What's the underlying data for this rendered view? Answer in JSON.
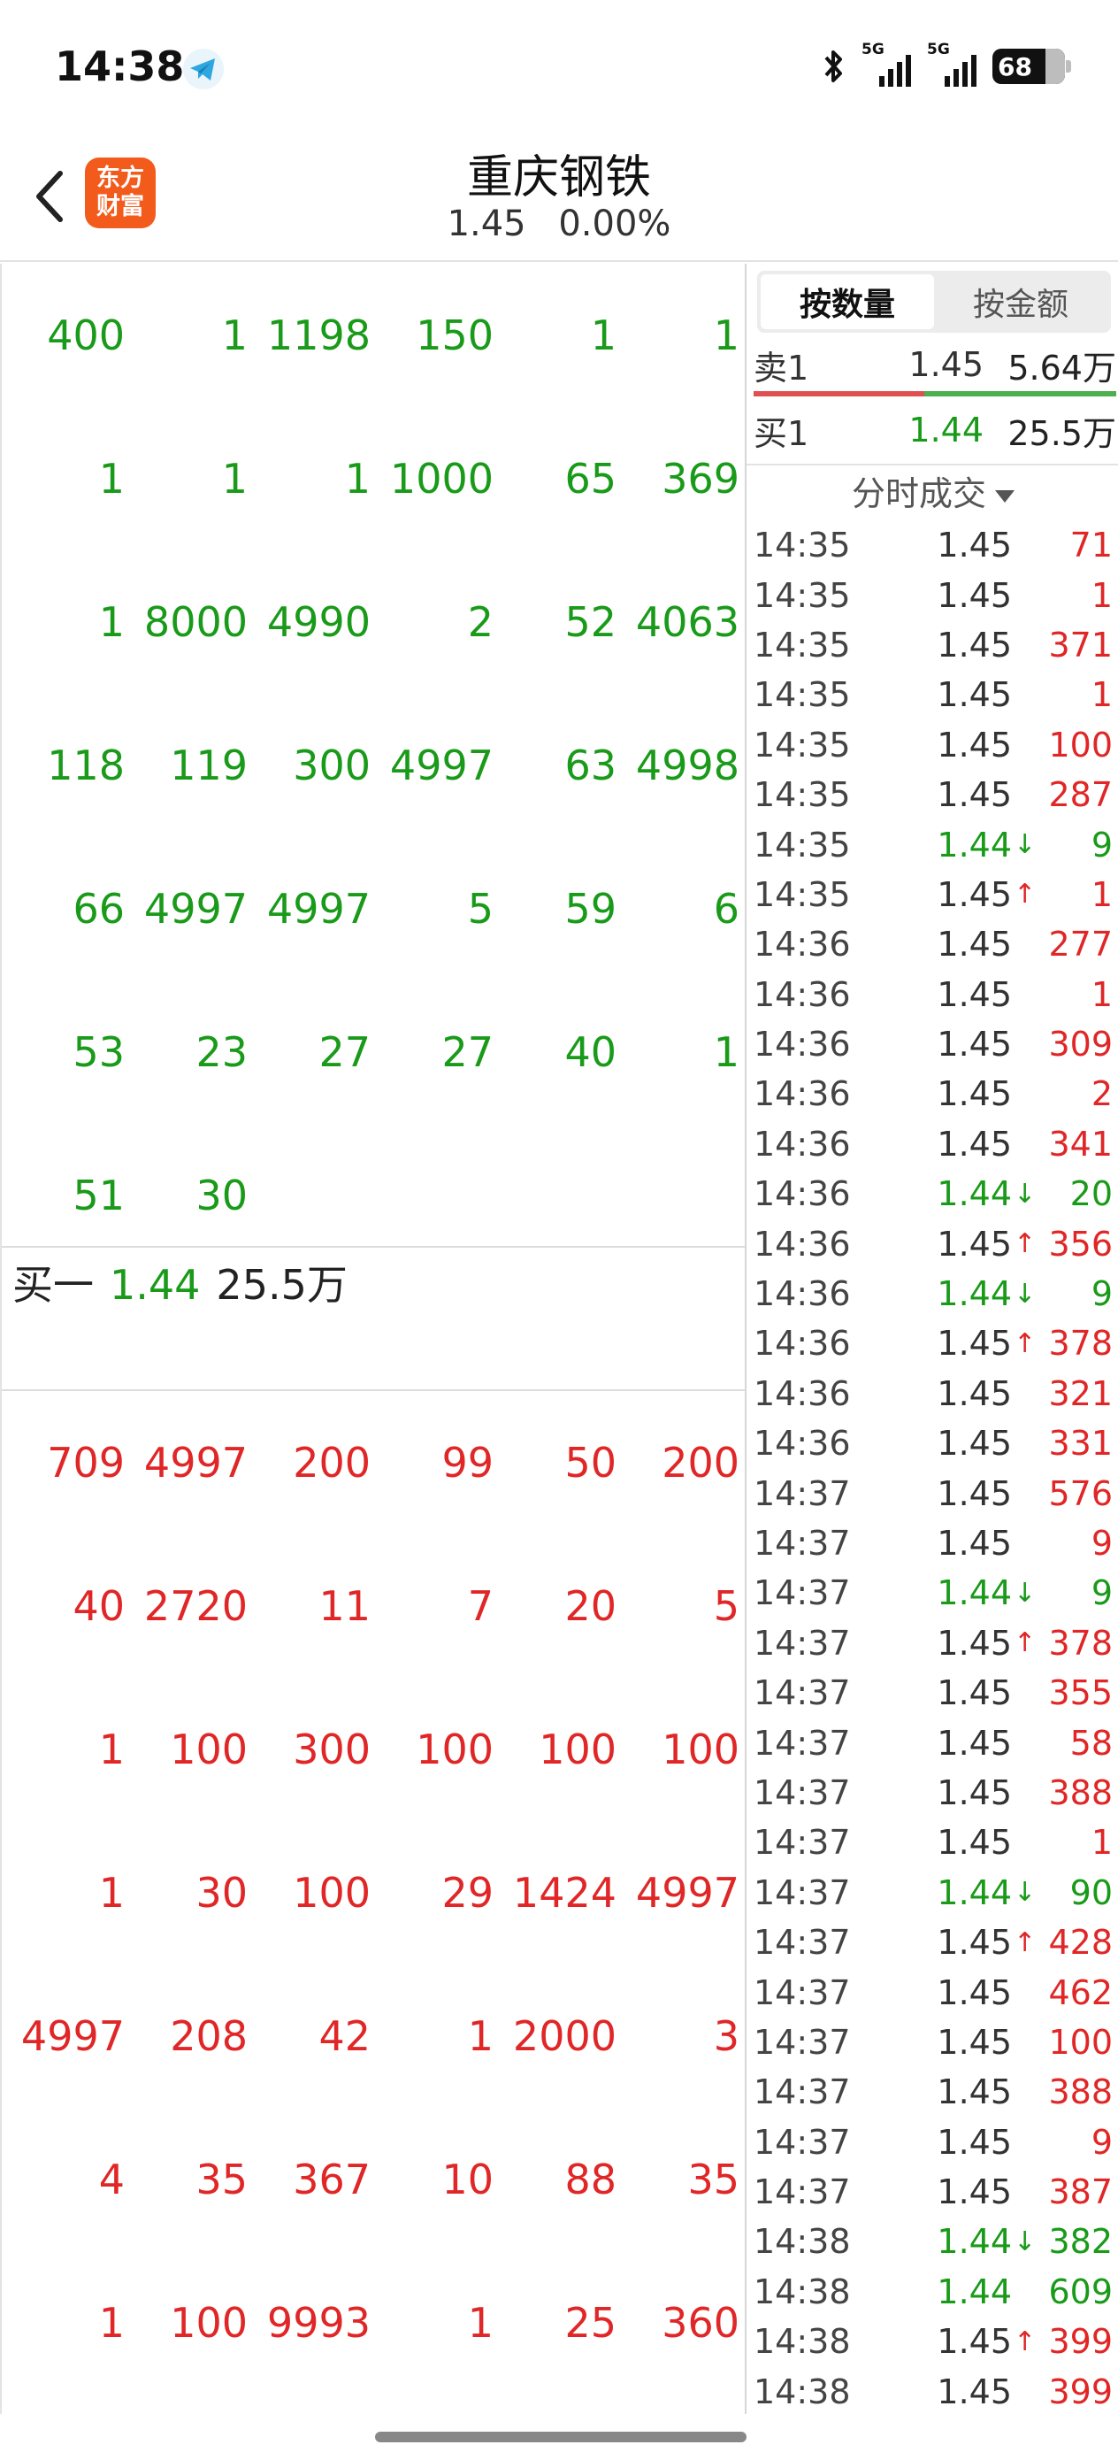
{
  "status_bar": {
    "time": "14:38",
    "net1": "5G",
    "net2": "5G",
    "battery": "68"
  },
  "header": {
    "logo": [
      "东方",
      "财富"
    ],
    "title": "重庆钢铁",
    "price": "1.45",
    "change": "0.00%"
  },
  "sell_queue": [
    [
      "400",
      "1",
      "1198",
      "150",
      "1",
      "1"
    ],
    [
      "1",
      "1",
      "1",
      "1000",
      "65",
      "369"
    ],
    [
      "1",
      "8000",
      "4990",
      "2",
      "52",
      "4063"
    ],
    [
      "118",
      "119",
      "300",
      "4997",
      "63",
      "4998"
    ],
    [
      "66",
      "4997",
      "4997",
      "5",
      "59",
      "6"
    ],
    [
      "53",
      "23",
      "27",
      "27",
      "40",
      "1"
    ],
    [
      "51",
      "30",
      "",
      "",
      "",
      ""
    ]
  ],
  "buy_one": {
    "label": "买一",
    "price": "1.44",
    "volume": "25.5万"
  },
  "buy_queue": [
    [
      "709",
      "4997",
      "200",
      "99",
      "50",
      "200"
    ],
    [
      "40",
      "2720",
      "11",
      "7",
      "20",
      "5"
    ],
    [
      "1",
      "100",
      "300",
      "100",
      "100",
      "100"
    ],
    [
      "1",
      "30",
      "100",
      "29",
      "1424",
      "4997"
    ],
    [
      "4997",
      "208",
      "42",
      "1",
      "2000",
      "3"
    ],
    [
      "4",
      "35",
      "367",
      "10",
      "88",
      "35"
    ],
    [
      "1",
      "100",
      "9993",
      "1",
      "25",
      "360"
    ]
  ],
  "right_panel": {
    "toggle": [
      "按数量",
      "按金额"
    ],
    "sell1": {
      "label": "卖1",
      "price": "1.45",
      "volume": "5.64万"
    },
    "buy1": {
      "label": "买1",
      "price": "1.44",
      "volume": "25.5万"
    },
    "trades_label": "分时成交"
  },
  "trades": [
    {
      "time": "14:35",
      "price": "1.45",
      "arrow": "",
      "vol": "71",
      "pc": "n",
      "vc": "r"
    },
    {
      "time": "14:35",
      "price": "1.45",
      "arrow": "",
      "vol": "1",
      "pc": "n",
      "vc": "r"
    },
    {
      "time": "14:35",
      "price": "1.45",
      "arrow": "",
      "vol": "371",
      "pc": "n",
      "vc": "r"
    },
    {
      "time": "14:35",
      "price": "1.45",
      "arrow": "",
      "vol": "1",
      "pc": "n",
      "vc": "r"
    },
    {
      "time": "14:35",
      "price": "1.45",
      "arrow": "",
      "vol": "100",
      "pc": "n",
      "vc": "r"
    },
    {
      "time": "14:35",
      "price": "1.45",
      "arrow": "",
      "vol": "287",
      "pc": "n",
      "vc": "r"
    },
    {
      "time": "14:35",
      "price": "1.44",
      "arrow": "↓",
      "vol": "9",
      "pc": "g",
      "vc": "g"
    },
    {
      "time": "14:35",
      "price": "1.45",
      "arrow": "↑",
      "vol": "1",
      "pc": "n",
      "vc": "r"
    },
    {
      "time": "14:36",
      "price": "1.45",
      "arrow": "",
      "vol": "277",
      "pc": "n",
      "vc": "r"
    },
    {
      "time": "14:36",
      "price": "1.45",
      "arrow": "",
      "vol": "1",
      "pc": "n",
      "vc": "r"
    },
    {
      "time": "14:36",
      "price": "1.45",
      "arrow": "",
      "vol": "309",
      "pc": "n",
      "vc": "r"
    },
    {
      "time": "14:36",
      "price": "1.45",
      "arrow": "",
      "vol": "2",
      "pc": "n",
      "vc": "r"
    },
    {
      "time": "14:36",
      "price": "1.45",
      "arrow": "",
      "vol": "341",
      "pc": "n",
      "vc": "r"
    },
    {
      "time": "14:36",
      "price": "1.44",
      "arrow": "↓",
      "vol": "20",
      "pc": "g",
      "vc": "g"
    },
    {
      "time": "14:36",
      "price": "1.45",
      "arrow": "↑",
      "vol": "356",
      "pc": "n",
      "vc": "r"
    },
    {
      "time": "14:36",
      "price": "1.44",
      "arrow": "↓",
      "vol": "9",
      "pc": "g",
      "vc": "g"
    },
    {
      "time": "14:36",
      "price": "1.45",
      "arrow": "↑",
      "vol": "378",
      "pc": "n",
      "vc": "r"
    },
    {
      "time": "14:36",
      "price": "1.45",
      "arrow": "",
      "vol": "321",
      "pc": "n",
      "vc": "r"
    },
    {
      "time": "14:36",
      "price": "1.45",
      "arrow": "",
      "vol": "331",
      "pc": "n",
      "vc": "r"
    },
    {
      "time": "14:37",
      "price": "1.45",
      "arrow": "",
      "vol": "576",
      "pc": "n",
      "vc": "r"
    },
    {
      "time": "14:37",
      "price": "1.45",
      "arrow": "",
      "vol": "9",
      "pc": "n",
      "vc": "r"
    },
    {
      "time": "14:37",
      "price": "1.44",
      "arrow": "↓",
      "vol": "9",
      "pc": "g",
      "vc": "g"
    },
    {
      "time": "14:37",
      "price": "1.45",
      "arrow": "↑",
      "vol": "378",
      "pc": "n",
      "vc": "r"
    },
    {
      "time": "14:37",
      "price": "1.45",
      "arrow": "",
      "vol": "355",
      "pc": "n",
      "vc": "r"
    },
    {
      "time": "14:37",
      "price": "1.45",
      "arrow": "",
      "vol": "58",
      "pc": "n",
      "vc": "r"
    },
    {
      "time": "14:37",
      "price": "1.45",
      "arrow": "",
      "vol": "388",
      "pc": "n",
      "vc": "r"
    },
    {
      "time": "14:37",
      "price": "1.45",
      "arrow": "",
      "vol": "1",
      "pc": "n",
      "vc": "r"
    },
    {
      "time": "14:37",
      "price": "1.44",
      "arrow": "↓",
      "vol": "90",
      "pc": "g",
      "vc": "g"
    },
    {
      "time": "14:37",
      "price": "1.45",
      "arrow": "↑",
      "vol": "428",
      "pc": "n",
      "vc": "r"
    },
    {
      "time": "14:37",
      "price": "1.45",
      "arrow": "",
      "vol": "462",
      "pc": "n",
      "vc": "r"
    },
    {
      "time": "14:37",
      "price": "1.45",
      "arrow": "",
      "vol": "100",
      "pc": "n",
      "vc": "r"
    },
    {
      "time": "14:37",
      "price": "1.45",
      "arrow": "",
      "vol": "388",
      "pc": "n",
      "vc": "r"
    },
    {
      "time": "14:37",
      "price": "1.45",
      "arrow": "",
      "vol": "9",
      "pc": "n",
      "vc": "r"
    },
    {
      "time": "14:37",
      "price": "1.45",
      "arrow": "",
      "vol": "387",
      "pc": "n",
      "vc": "r"
    },
    {
      "time": "14:38",
      "price": "1.44",
      "arrow": "↓",
      "vol": "382",
      "pc": "g",
      "vc": "g"
    },
    {
      "time": "14:38",
      "price": "1.44",
      "arrow": "",
      "vol": "609",
      "pc": "g",
      "vc": "g"
    },
    {
      "time": "14:38",
      "price": "1.45",
      "arrow": "↑",
      "vol": "399",
      "pc": "n",
      "vc": "r"
    },
    {
      "time": "14:38",
      "price": "1.45",
      "arrow": "",
      "vol": "399",
      "pc": "n",
      "vc": "r"
    }
  ],
  "colors": {
    "green": "#199a19",
    "red": "#e02626",
    "logo": "#f35b1c"
  }
}
